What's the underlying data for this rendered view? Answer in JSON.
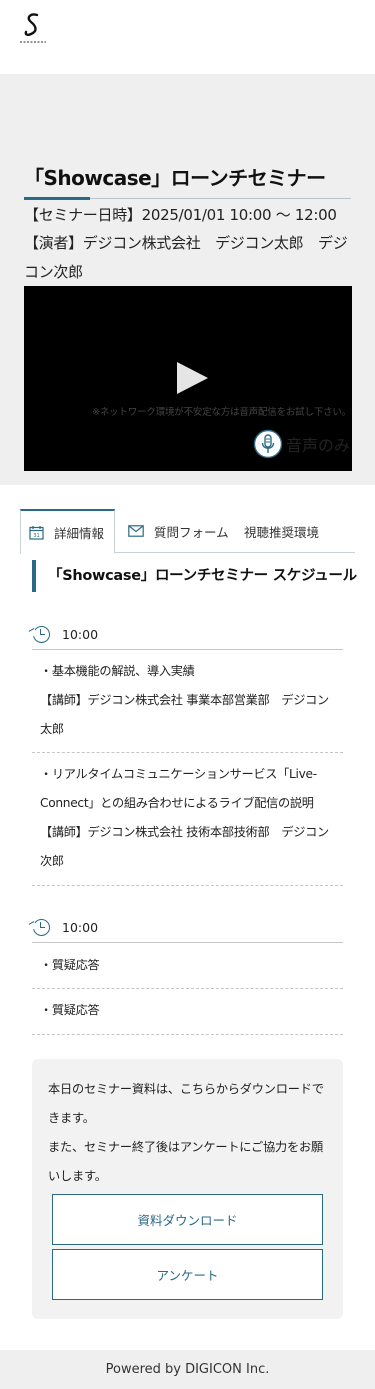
{
  "header": {
    "logo_icon": "company-logo-icon"
  },
  "hero": {
    "title": "「Showcase」ローンチセミナー",
    "datetime": "【セミナー日時】2025/01/01 10:00 〜 12:00",
    "presenters": "【演者】デジコン株式会社　デジコン太郎　デジコン次郎",
    "network_notice": "※ネットワーク環境が不安定な方は音声配信をお試し下さい。",
    "audio_only_label": "音声のみ"
  },
  "tabs": [
    {
      "label": "詳細情報",
      "icon": "calendar-icon",
      "active": true
    },
    {
      "label": "質問フォーム",
      "icon": "mail-icon",
      "active": false
    },
    {
      "label": "視聴推奨環境",
      "active": false
    }
  ],
  "schedule": {
    "title": "「Showcase」ローンチセミナー スケジュール",
    "blocks": [
      {
        "time": "10:00",
        "items": [
          [
            "・基本機能の解説、導入実績",
            "【講師】デジコン株式会社 事業本部営業部　デジコン太郎"
          ],
          [
            "・リアルタイムコミュニケーションサービス「Live-Connect」との組み合わせによるライブ配信の説明",
            "【講師】デジコン株式会社 技術本部技術部　デジコン次郎"
          ]
        ]
      },
      {
        "time": "10:00",
        "items": [
          [
            "・質疑応答"
          ],
          [
            "・質疑応答"
          ]
        ]
      }
    ]
  },
  "download": {
    "text_1": "本日のセミナー資料は、こちらからダウンロードできます。",
    "text_2": "また、セミナー終了後はアンケートにご協力をお願いします。",
    "download_button": "資料ダウンロード",
    "survey_button": "アンケート"
  },
  "footer": {
    "text": "Powered by DIGICON Inc."
  },
  "colors": {
    "accent": "#2a6a86",
    "hero_bg": "#efefef",
    "video_bg": "#000000"
  }
}
